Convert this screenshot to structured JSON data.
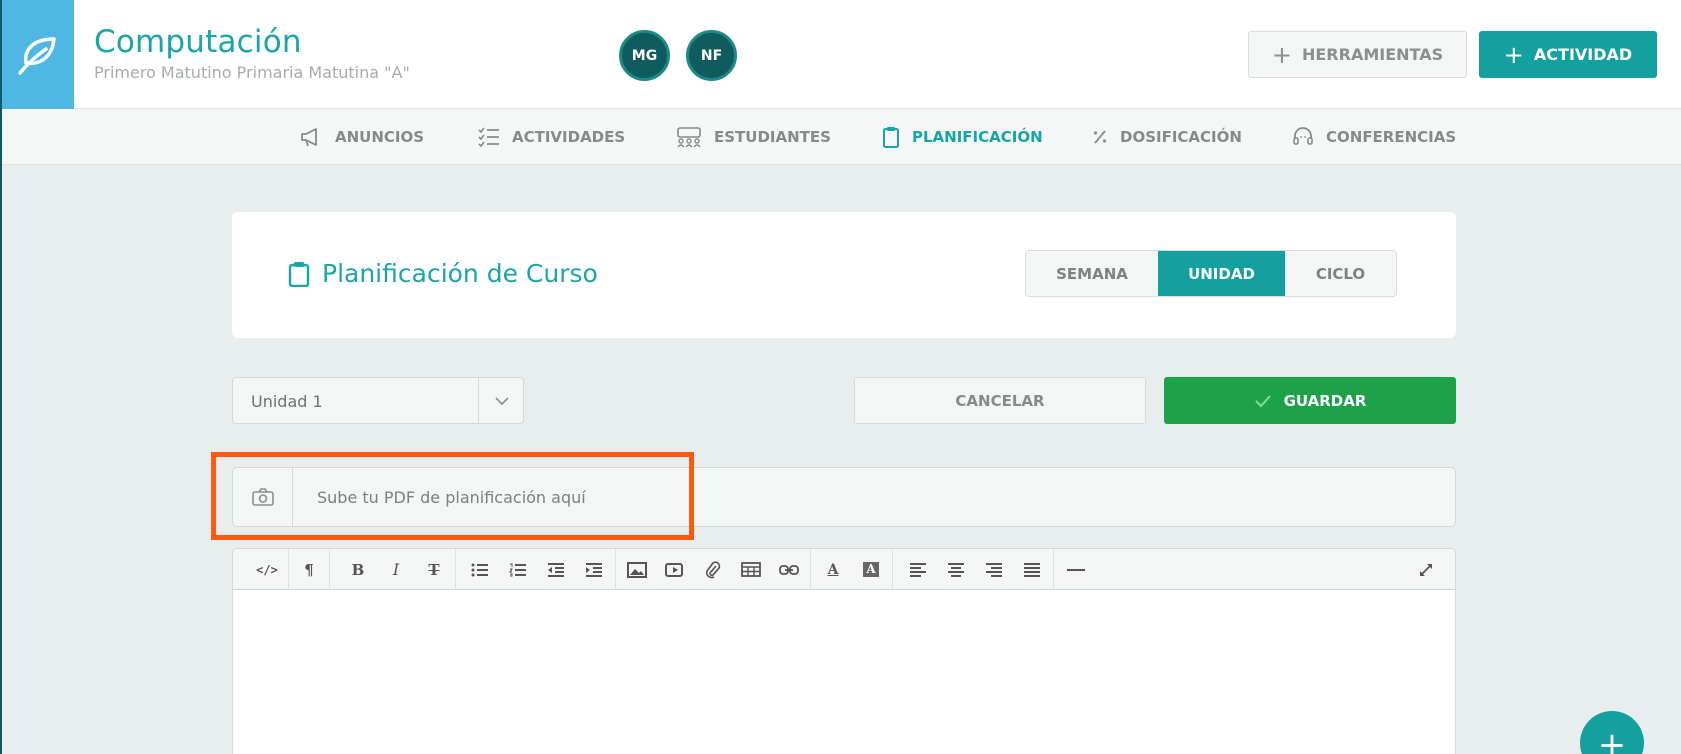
{
  "header": {
    "course_title": "Computación",
    "course_subtitle": "Primero Matutino Primaria Matutina \"A\"",
    "avatars": [
      "MG",
      "NF"
    ],
    "tools_label": "HERRAMIENTAS",
    "activity_label": "ACTIVIDAD"
  },
  "nav": {
    "items": [
      {
        "label": "ANUNCIOS",
        "icon": "megaphone-icon"
      },
      {
        "label": "ACTIVIDADES",
        "icon": "checklist-icon"
      },
      {
        "label": "ESTUDIANTES",
        "icon": "students-icon"
      },
      {
        "label": "PLANIFICACIÓN",
        "icon": "clipboard-icon"
      },
      {
        "label": "DOSIFICACIÓN",
        "icon": "percent-icon"
      },
      {
        "label": "CONFERENCIAS",
        "icon": "headset-icon"
      }
    ],
    "active": "PLANIFICACIÓN"
  },
  "card": {
    "title": "Planificación de Curso",
    "segments": [
      "SEMANA",
      "UNIDAD",
      "CICLO"
    ],
    "selected_segment": "UNIDAD"
  },
  "unit_select": {
    "value": "Unidad 1"
  },
  "actions": {
    "cancel_label": "CANCELAR",
    "save_label": "GUARDAR"
  },
  "upload": {
    "placeholder": "Sube tu PDF de planificación aquí"
  },
  "colors": {
    "accent": "#15a0a0",
    "save_green": "#1da24a",
    "logo_blue": "#4fb7e3",
    "highlight": "#ff5a0f"
  }
}
